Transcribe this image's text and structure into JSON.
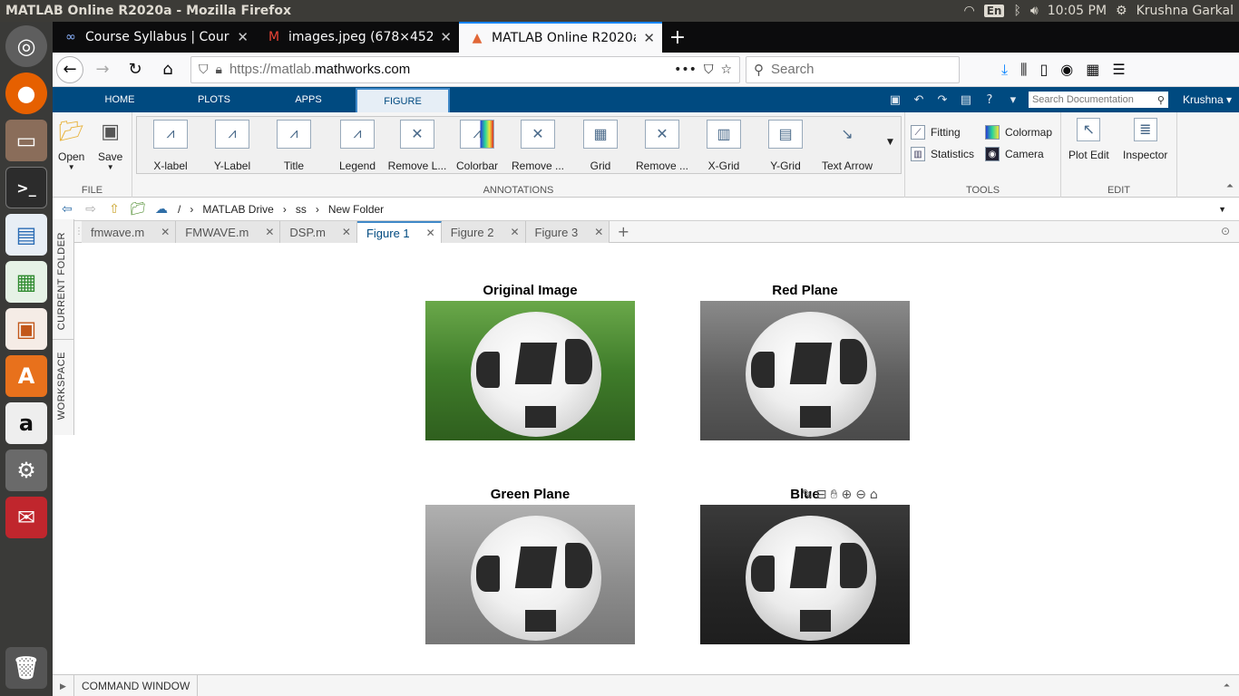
{
  "os": {
    "window_title": "MATLAB Online R2020a - Mozilla Firefox",
    "lang": "En",
    "clock": "10:05 PM",
    "user": "Krushna Garkal"
  },
  "browser": {
    "tabs": [
      {
        "label": "Course Syllabus | Course",
        "icon": "link-icon"
      },
      {
        "label": "images.jpeg (678×452) -",
        "icon": "gmail-icon"
      },
      {
        "label": "MATLAB Online R2020a",
        "icon": "matlab-icon"
      }
    ],
    "url_prefix": "https://matlab.",
    "url_domain": "mathworks.com",
    "search_placeholder": "Search"
  },
  "matlab": {
    "tabs": [
      "HOME",
      "PLOTS",
      "APPS",
      "FIGURE"
    ],
    "doc_search_placeholder": "Search Documentation",
    "user": "Krushna",
    "file_group": {
      "label": "FILE",
      "open": "Open",
      "save": "Save"
    },
    "annotations_group": {
      "label": "ANNOTATIONS",
      "buttons": [
        "X-label",
        "Y-Label",
        "Title",
        "Legend",
        "Remove L...",
        "Colorbar",
        "Remove ...",
        "Grid",
        "Remove ...",
        "X-Grid",
        "Y-Grid",
        "Text Arrow"
      ]
    },
    "tools_group": {
      "label": "TOOLS",
      "fitting": "Fitting",
      "statistics": "Statistics",
      "colormap": "Colormap",
      "camera": "Camera"
    },
    "edit_group": {
      "label": "EDIT",
      "plot_edit": "Plot Edit",
      "inspector": "Inspector"
    },
    "path": {
      "root": "/",
      "parts": [
        "MATLAB Drive",
        "ss",
        "New Folder"
      ]
    },
    "side_labels": {
      "current_folder": "CURRENT FOLDER",
      "workspace": "WORKSPACE"
    },
    "doc_tabs": [
      "fmwave.m",
      "FMWAVE.m",
      "DSP.m",
      "Figure 1",
      "Figure 2",
      "Figure 3"
    ],
    "active_doc_tab": "Figure 1",
    "subplots": [
      {
        "title": "Original Image"
      },
      {
        "title": "Red Plane"
      },
      {
        "title": "Green Plane"
      },
      {
        "title": "Blue"
      }
    ],
    "command_window": "COMMAND WINDOW"
  }
}
